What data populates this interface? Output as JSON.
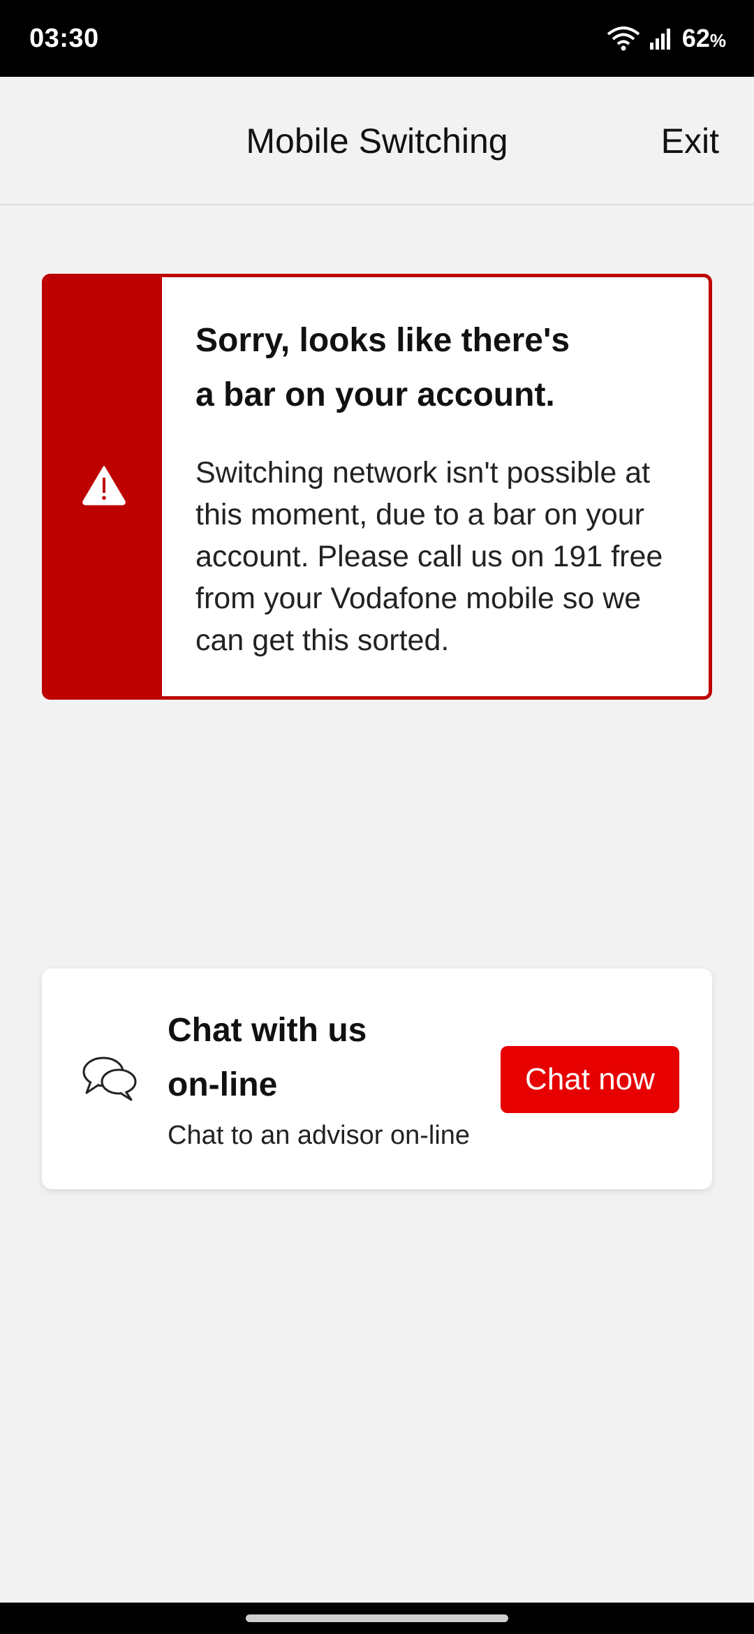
{
  "status_bar": {
    "time": "03:30",
    "battery": "62",
    "battery_unit": "%",
    "icons": [
      "wifi-icon",
      "signal-icon"
    ]
  },
  "header": {
    "title": "Mobile Switching",
    "exit_label": "Exit"
  },
  "error_card": {
    "icon": "warning-icon",
    "title": "Sorry, looks like there's a bar on your account.",
    "message": "Switching network isn't possible at this moment, due to a bar on your account. Please call us on 191 free from your Vodafone mobile so we can get this sorted.",
    "accent_color": "#bd0000"
  },
  "chat_card": {
    "icon": "chat-bubbles-icon",
    "title": "Chat with us on-line",
    "subtitle": "Chat to an advisor on-line",
    "button_label": "Chat now",
    "button_color": "#e60000"
  }
}
